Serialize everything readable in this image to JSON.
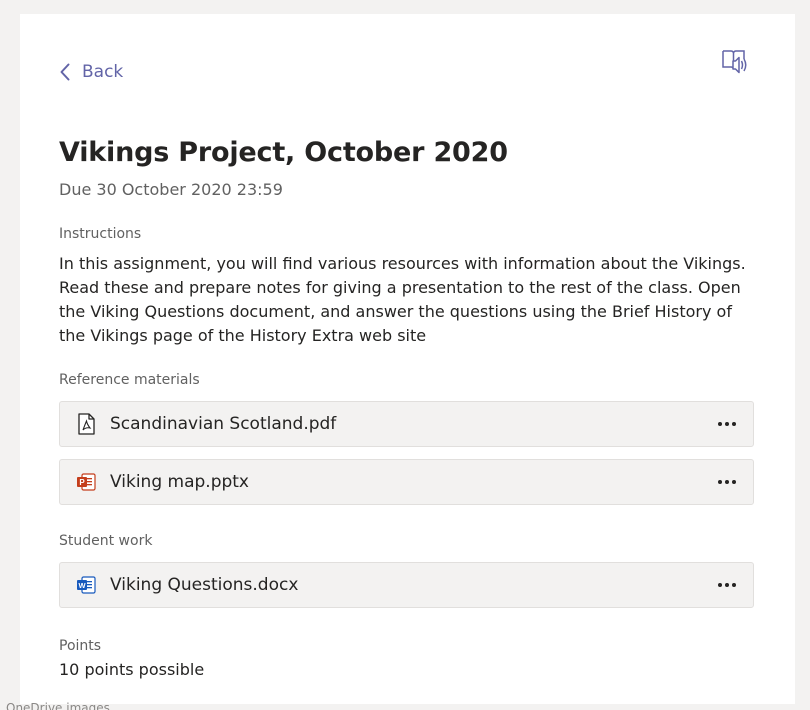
{
  "header": {
    "back_label": "Back",
    "reader_icon": "immersive-reader-icon"
  },
  "assignment": {
    "title": "Vikings Project, October 2020",
    "due": "Due 30 October 2020 23:59",
    "instructions_label": "Instructions",
    "instructions_text": "In this assignment, you will find various resources with information about the Vikings. Read these and prepare notes for giving a presentation to the rest of the class. Open the Viking Questions  document, and answer the questions using the Brief History of the Vikings page of the History Extra web site"
  },
  "reference": {
    "label": "Reference materials",
    "files": [
      {
        "name": "Scandinavian Scotland.pdf",
        "icon": "pdf-file-icon"
      },
      {
        "name": "Viking map.pptx",
        "icon": "powerpoint-file-icon"
      }
    ]
  },
  "student_work": {
    "label": "Student work",
    "files": [
      {
        "name": "Viking Questions.docx",
        "icon": "word-file-icon"
      }
    ]
  },
  "points": {
    "label": "Points",
    "value": "10 points possible"
  },
  "footer": {
    "ghost_text": "OneDrive images"
  },
  "colors": {
    "accent": "#6264a7",
    "card_bg": "#f3f2f1",
    "powerpoint": "#c43e1c",
    "word": "#185abd"
  }
}
